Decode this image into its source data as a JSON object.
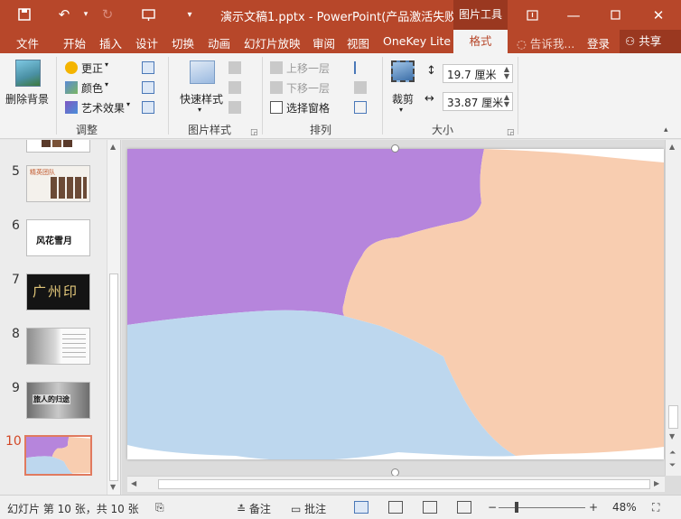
{
  "titlebar": {
    "title": "演示文稿1.pptx - PowerPoint(产品激活失败)",
    "context_tab": "图片工具",
    "icons": [
      "save-icon",
      "undo-icon",
      "redo-icon",
      "slideshow-icon",
      "customize-icon",
      "ribbon-display-icon",
      "minimize-icon",
      "maximize-icon",
      "close-icon"
    ]
  },
  "tabs": [
    "文件",
    "开始",
    "插入",
    "设计",
    "切换",
    "动画",
    "幻灯片放映",
    "审阅",
    "视图",
    "OneKey Lite",
    "格式"
  ],
  "active_tab": "格式",
  "tell_me": "告诉我...",
  "login": "登录",
  "share": "共享",
  "ribbon": {
    "remove_bg": "删除背景",
    "adjust": {
      "corrections": "更正",
      "color": "颜色",
      "art_effects": "艺术效果",
      "label": "调整"
    },
    "picture_styles": {
      "quick_styles": "快速样式",
      "label": "图片样式"
    },
    "arrange": {
      "bring_forward": "上移一层",
      "send_backward": "下移一层",
      "selection_pane": "选择窗格",
      "label": "排列"
    },
    "size": {
      "crop": "裁剪",
      "height": "19.7 厘米",
      "width": "33.87 厘米",
      "label": "大小"
    }
  },
  "thumbnails": [
    {
      "num": "5",
      "title": "精英团队"
    },
    {
      "num": "6",
      "title": "风花雪月"
    },
    {
      "num": "7",
      "title": "广州印"
    },
    {
      "num": "8",
      "title": ""
    },
    {
      "num": "9",
      "title": "旅人的归途"
    },
    {
      "num": "10",
      "title": ""
    }
  ],
  "active_slide": "10",
  "status": {
    "slide_info": "幻灯片 第 10 张，共 10 张",
    "notes": "备注",
    "comments": "批注",
    "zoom": "48%"
  },
  "colors": {
    "accent": "#b7472a",
    "purple_region": "#b685dc",
    "peach_region": "#f8cdb0",
    "blue_region": "#bdd7ee"
  }
}
